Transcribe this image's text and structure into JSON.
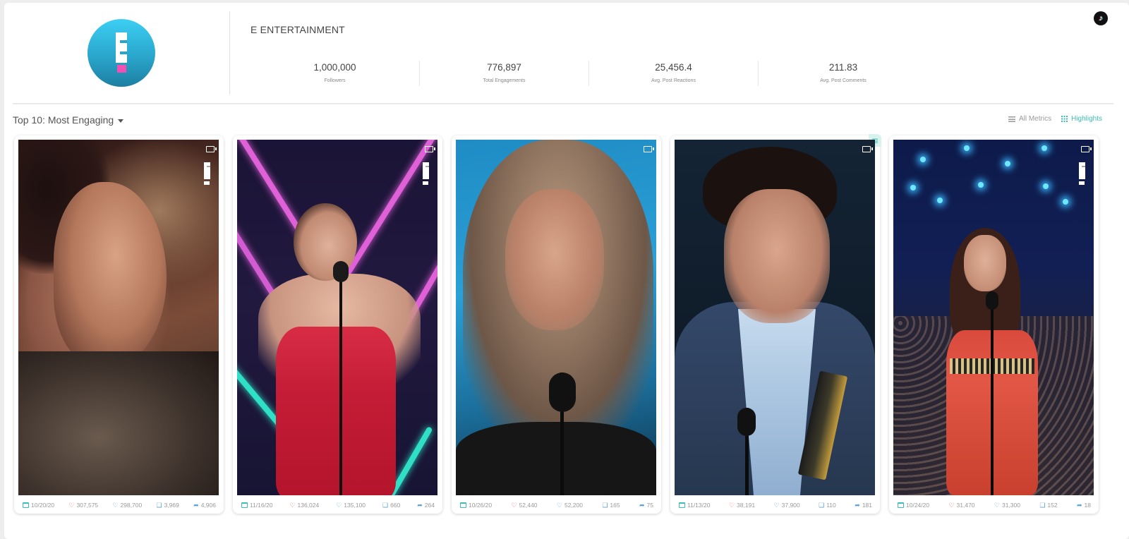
{
  "account": {
    "name": "E ENTERTAINMENT",
    "platform_icon": "tiktok-icon",
    "logo": "e-entertainment-logo"
  },
  "stats": [
    {
      "value": "1,000,000",
      "label": "Followers"
    },
    {
      "value": "776,897",
      "label": "Total Engagements"
    },
    {
      "value": "25,456.4",
      "label": "Avg. Post Reactions"
    },
    {
      "value": "211.83",
      "label": "Avg. Post Comments"
    }
  ],
  "section": {
    "title": "Top 10: Most Engaging",
    "dropdown_icon": "caret-down-icon"
  },
  "view_toggle": {
    "all_metrics_label": "All Metrics",
    "highlights_label": "Highlights",
    "active": "Highlights",
    "accent_color": "#3bbfb5"
  },
  "posts": [
    {
      "date": "10/20/20",
      "reactions": "307,575",
      "likes": "298,700",
      "comments": "3,969",
      "shares": "4,906",
      "media_type": "video",
      "has_doc_badge": false
    },
    {
      "date": "11/16/20",
      "reactions": "136,024",
      "likes": "135,100",
      "comments": "660",
      "shares": "264",
      "media_type": "video",
      "has_doc_badge": false
    },
    {
      "date": "10/26/20",
      "reactions": "52,440",
      "likes": "52,200",
      "comments": "165",
      "shares": "75",
      "media_type": "video",
      "has_doc_badge": false
    },
    {
      "date": "11/13/20",
      "reactions": "38,191",
      "likes": "37,900",
      "comments": "110",
      "shares": "181",
      "media_type": "video",
      "has_doc_badge": true
    },
    {
      "date": "10/24/20",
      "reactions": "31,470",
      "likes": "31,300",
      "comments": "152",
      "shares": "18",
      "media_type": "video",
      "has_doc_badge": false
    }
  ],
  "icons": {
    "date": "calendar-icon",
    "reactions": "heart-pulse-icon",
    "likes": "heart-outline-icon",
    "comments": "comments-icon",
    "shares": "share-icon",
    "media": "video-camera-icon",
    "doc_badge": "document-icon"
  },
  "glyphs": {
    "tiktok": "♪",
    "reactions": "♡",
    "likes": "♡",
    "comments": "❑",
    "shares": "➦",
    "doc": "▤"
  }
}
